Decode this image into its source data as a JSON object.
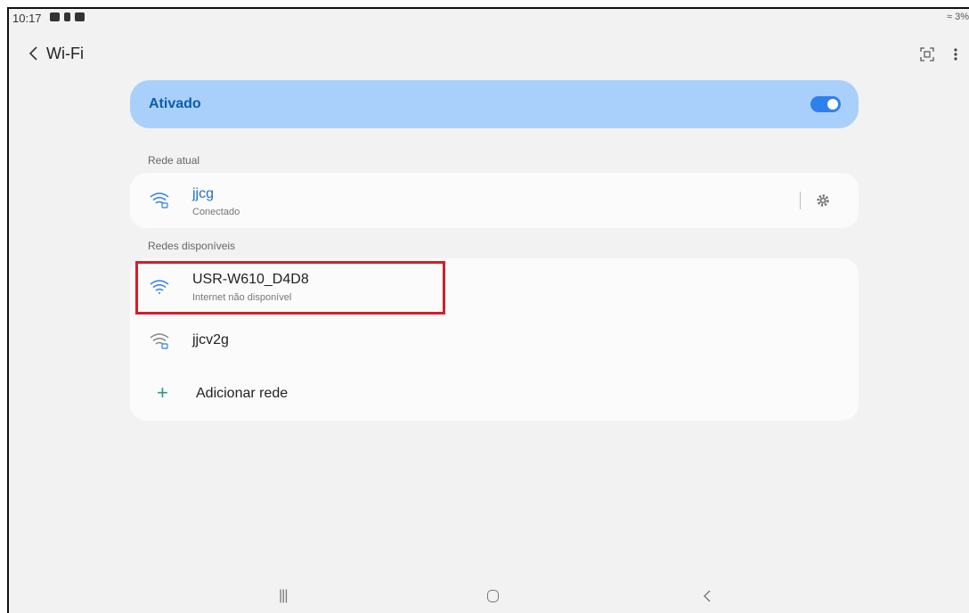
{
  "status": {
    "time": "10:17",
    "right": "≈ 3%"
  },
  "header": {
    "title": "Wi-Fi"
  },
  "toggle": {
    "label": "Ativado"
  },
  "current": {
    "section_label": "Rede atual",
    "name": "jjcg",
    "status": "Conectado"
  },
  "available": {
    "section_label": "Redes disponíveis",
    "networks": [
      {
        "name": "USR-W610_D4D8",
        "status": "Internet não disponível"
      },
      {
        "name": "jjcv2g"
      }
    ],
    "add_label": "Adicionar rede"
  },
  "colors": {
    "accent": "#2f80ed",
    "highlight": "#d11f2a",
    "toggle_card": "#a9d0fa"
  },
  "icons": [
    "wifi-icon",
    "wifi-lock-icon",
    "gear-icon",
    "plus-icon",
    "qr-scan-icon",
    "more-vert-icon",
    "back-arrow-icon"
  ]
}
